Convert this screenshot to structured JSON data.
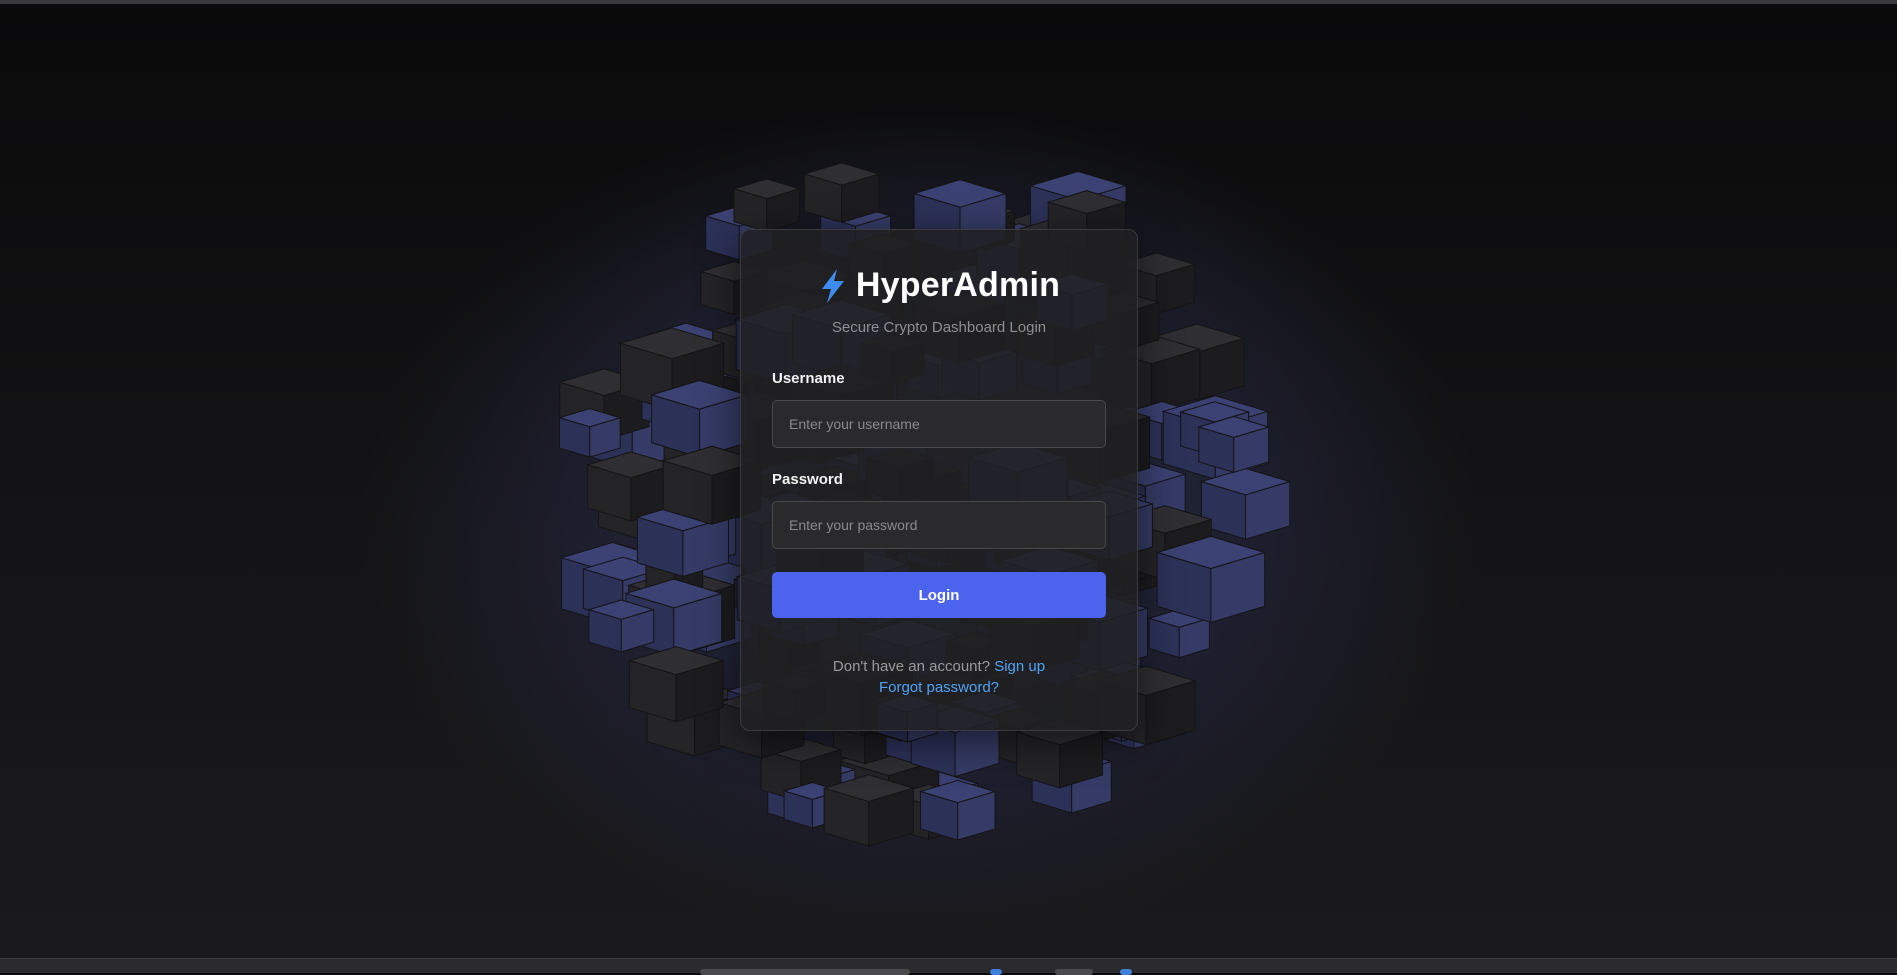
{
  "brand": {
    "title": "HyperAdmin",
    "icon": "lightning-bolt-icon",
    "subtitle": "Secure Crypto Dashboard Login"
  },
  "form": {
    "username_label": "Username",
    "username_placeholder": "Enter your username",
    "username_value": "",
    "password_label": "Password",
    "password_placeholder": "Enter your password",
    "password_value": "",
    "login_label": "Login"
  },
  "footer": {
    "no_account_text": "Don't have an account?",
    "signup_label": "Sign up",
    "forgot_label": "Forgot password?"
  },
  "colors": {
    "accent": "#4c63ee",
    "link": "#4ea3f7",
    "background": "#0b0b0c",
    "card": "#202022"
  }
}
